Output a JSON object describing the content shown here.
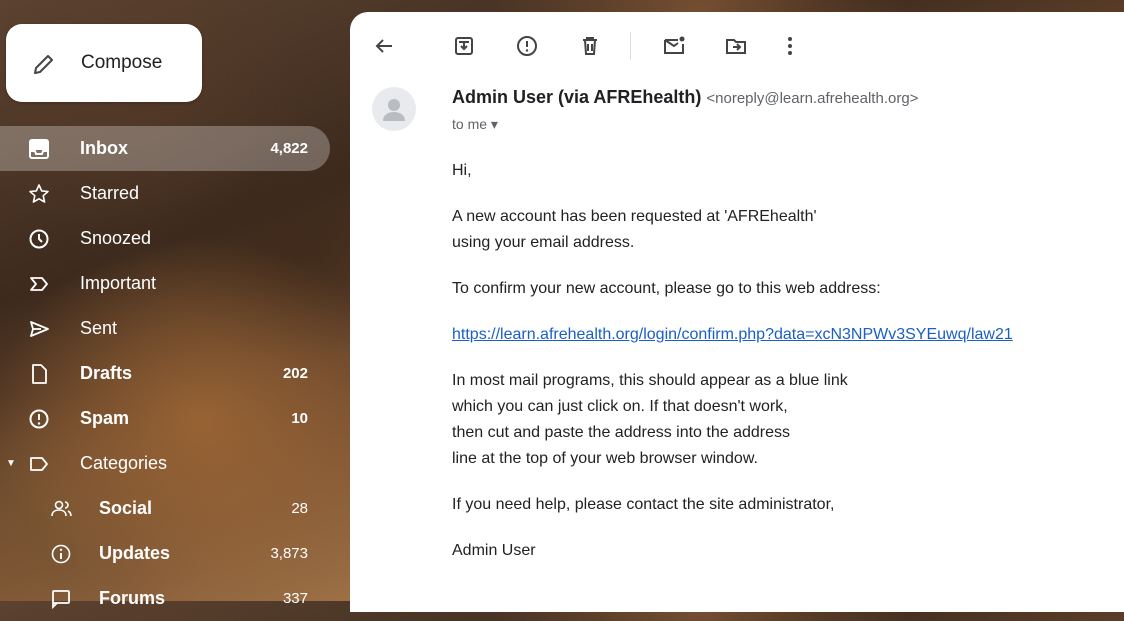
{
  "compose": {
    "label": "Compose",
    "icon": "pencil-icon"
  },
  "nav": {
    "inbox": {
      "label": "Inbox",
      "count": "4,822"
    },
    "starred": {
      "label": "Starred"
    },
    "snoozed": {
      "label": "Snoozed"
    },
    "important": {
      "label": "Important"
    },
    "sent": {
      "label": "Sent"
    },
    "drafts": {
      "label": "Drafts",
      "count": "202"
    },
    "spam": {
      "label": "Spam",
      "count": "10"
    },
    "categories": {
      "label": "Categories"
    },
    "social": {
      "label": "Social",
      "count": "28"
    },
    "updates": {
      "label": "Updates",
      "count": "3,873"
    },
    "forums": {
      "label": "Forums",
      "count": "337"
    }
  },
  "email": {
    "sender_name": "Admin User (via AFREhealth)",
    "sender_address": "<noreply@learn.afrehealth.org>",
    "to_me": "to me ▾",
    "greeting": "Hi,",
    "line1": "A new account has been requested at 'AFREhealth'",
    "line2": "using your email address.",
    "line3": "To confirm your new account, please go to this web address:",
    "link": "https://learn.afrehealth.org/login/confirm.php?data=xcN3NPWv3SYEuwq/law21",
    "line4": "In most mail programs, this should appear as a blue link",
    "line5": "which you can just click on. If that doesn't work,",
    "line6": "then cut and paste the address into the address",
    "line7": "line at the top of your web browser window.",
    "line8": "If you need help, please contact the site administrator,",
    "signature": "Admin User"
  },
  "colors": {
    "link": "#1a5fc8",
    "text": "#222222"
  }
}
